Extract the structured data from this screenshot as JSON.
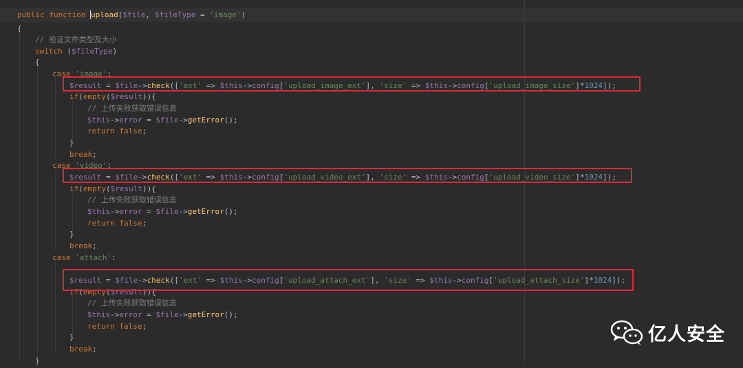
{
  "code": {
    "lines": [
      {
        "tokens": [
          {
            "t": "kw",
            "s": "public function "
          },
          {
            "t": "fnname",
            "s": "upload"
          },
          {
            "t": "p",
            "s": "("
          },
          {
            "t": "var",
            "s": "$file"
          },
          {
            "t": "p",
            "s": ", "
          },
          {
            "t": "var",
            "s": "$fileType"
          },
          {
            "t": "p",
            "s": " = "
          },
          {
            "t": "str",
            "s": "'image'"
          },
          {
            "t": "p",
            "s": ")"
          }
        ]
      },
      {
        "tokens": [
          {
            "t": "p",
            "s": "{"
          }
        ]
      },
      {
        "tokens": [
          {
            "t": "cm",
            "s": "// 验证文件类型及大小"
          }
        ]
      },
      {
        "tokens": [
          {
            "t": "kw",
            "s": "switch "
          },
          {
            "t": "p",
            "s": "("
          },
          {
            "t": "var",
            "s": "$fileType"
          },
          {
            "t": "p",
            "s": ")"
          }
        ]
      },
      {
        "tokens": [
          {
            "t": "p",
            "s": "{"
          }
        ]
      },
      {
        "tokens": [
          {
            "t": "kw",
            "s": "case "
          },
          {
            "t": "str",
            "s": "'image'"
          },
          {
            "t": "p",
            "s": ":"
          }
        ]
      },
      {
        "tokens": [
          {
            "t": "var",
            "s": "$result"
          },
          {
            "t": "p",
            "s": " = "
          },
          {
            "t": "var",
            "s": "$file"
          },
          {
            "t": "p",
            "s": "->"
          },
          {
            "t": "fn",
            "s": "check"
          },
          {
            "t": "p",
            "s": "(["
          },
          {
            "t": "str",
            "s": "'ext'"
          },
          {
            "t": "p",
            "s": " => "
          },
          {
            "t": "var",
            "s": "$this"
          },
          {
            "t": "p",
            "s": "->"
          },
          {
            "t": "var",
            "s": "config"
          },
          {
            "t": "p",
            "s": "["
          },
          {
            "t": "str",
            "s": "'upload_image_ext'"
          },
          {
            "t": "p",
            "s": "], "
          },
          {
            "t": "str",
            "s": "'size'"
          },
          {
            "t": "p",
            "s": " => "
          },
          {
            "t": "var",
            "s": "$this"
          },
          {
            "t": "p",
            "s": "->"
          },
          {
            "t": "var",
            "s": "config"
          },
          {
            "t": "p",
            "s": "["
          },
          {
            "t": "str",
            "s": "'upload_image_size'"
          },
          {
            "t": "p",
            "s": "]*"
          },
          {
            "t": "num",
            "s": "1024"
          },
          {
            "t": "p",
            "s": "]);"
          }
        ]
      },
      {
        "tokens": [
          {
            "t": "kw",
            "s": "if"
          },
          {
            "t": "p",
            "s": "("
          },
          {
            "t": "kw",
            "s": "empty"
          },
          {
            "t": "p",
            "s": "("
          },
          {
            "t": "var",
            "s": "$result"
          },
          {
            "t": "p",
            "s": ")){"
          }
        ]
      },
      {
        "tokens": [
          {
            "t": "cm",
            "s": "// 上传失败获取错误信息"
          }
        ]
      },
      {
        "tokens": [
          {
            "t": "var",
            "s": "$this"
          },
          {
            "t": "p",
            "s": "->"
          },
          {
            "t": "var",
            "s": "error"
          },
          {
            "t": "p",
            "s": " = "
          },
          {
            "t": "var",
            "s": "$file"
          },
          {
            "t": "p",
            "s": "->"
          },
          {
            "t": "fn",
            "s": "getError"
          },
          {
            "t": "p",
            "s": "();"
          }
        ]
      },
      {
        "tokens": [
          {
            "t": "kw",
            "s": "return false"
          },
          {
            "t": "p",
            "s": ";"
          }
        ]
      },
      {
        "tokens": [
          {
            "t": "p",
            "s": "}"
          }
        ]
      },
      {
        "tokens": [
          {
            "t": "kw",
            "s": "break"
          },
          {
            "t": "p",
            "s": ";"
          }
        ]
      },
      {
        "tokens": [
          {
            "t": "kw",
            "s": "case "
          },
          {
            "t": "str",
            "s": "'video'"
          },
          {
            "t": "p",
            "s": ":"
          }
        ]
      },
      {
        "tokens": [
          {
            "t": "var",
            "s": "$result"
          },
          {
            "t": "p",
            "s": " = "
          },
          {
            "t": "var",
            "s": "$file"
          },
          {
            "t": "p",
            "s": "->"
          },
          {
            "t": "fn",
            "s": "check"
          },
          {
            "t": "p",
            "s": "(["
          },
          {
            "t": "str",
            "s": "'ext'"
          },
          {
            "t": "p",
            "s": " => "
          },
          {
            "t": "var",
            "s": "$this"
          },
          {
            "t": "p",
            "s": "->"
          },
          {
            "t": "var",
            "s": "config"
          },
          {
            "t": "p",
            "s": "["
          },
          {
            "t": "str",
            "s": "'upload_video_ext'"
          },
          {
            "t": "p",
            "s": "], "
          },
          {
            "t": "str",
            "s": "'size'"
          },
          {
            "t": "p",
            "s": " => "
          },
          {
            "t": "var",
            "s": "$this"
          },
          {
            "t": "p",
            "s": "->"
          },
          {
            "t": "var",
            "s": "config"
          },
          {
            "t": "p",
            "s": "["
          },
          {
            "t": "str",
            "s": "'upload_video_size'"
          },
          {
            "t": "p",
            "s": "]*"
          },
          {
            "t": "num",
            "s": "1024"
          },
          {
            "t": "p",
            "s": "]);"
          }
        ]
      },
      {
        "tokens": [
          {
            "t": "kw",
            "s": "if"
          },
          {
            "t": "p",
            "s": "("
          },
          {
            "t": "kw",
            "s": "empty"
          },
          {
            "t": "p",
            "s": "("
          },
          {
            "t": "var",
            "s": "$result"
          },
          {
            "t": "p",
            "s": ")){"
          }
        ]
      },
      {
        "tokens": [
          {
            "t": "cm",
            "s": "// 上传失败获取错误信息"
          }
        ]
      },
      {
        "tokens": [
          {
            "t": "var",
            "s": "$this"
          },
          {
            "t": "p",
            "s": "->"
          },
          {
            "t": "var",
            "s": "error"
          },
          {
            "t": "p",
            "s": " = "
          },
          {
            "t": "var",
            "s": "$file"
          },
          {
            "t": "p",
            "s": "->"
          },
          {
            "t": "fn",
            "s": "getError"
          },
          {
            "t": "p",
            "s": "();"
          }
        ]
      },
      {
        "tokens": [
          {
            "t": "kw",
            "s": "return false"
          },
          {
            "t": "p",
            "s": ";"
          }
        ]
      },
      {
        "tokens": [
          {
            "t": "p",
            "s": "}"
          }
        ]
      },
      {
        "tokens": [
          {
            "t": "kw",
            "s": "break"
          },
          {
            "t": "p",
            "s": ";"
          }
        ]
      },
      {
        "tokens": [
          {
            "t": "kw",
            "s": "case "
          },
          {
            "t": "str",
            "s": "'attach'"
          },
          {
            "t": "p",
            "s": ":"
          }
        ]
      },
      {
        "tokens": []
      },
      {
        "tokens": [
          {
            "t": "var",
            "s": "$result"
          },
          {
            "t": "p",
            "s": " = "
          },
          {
            "t": "var",
            "s": "$file"
          },
          {
            "t": "p",
            "s": "->"
          },
          {
            "t": "fn",
            "s": "check"
          },
          {
            "t": "p",
            "s": "(["
          },
          {
            "t": "str",
            "s": "'ext'"
          },
          {
            "t": "p",
            "s": " => "
          },
          {
            "t": "var",
            "s": "$this"
          },
          {
            "t": "p",
            "s": "->"
          },
          {
            "t": "var",
            "s": "config"
          },
          {
            "t": "p",
            "s": "["
          },
          {
            "t": "str",
            "s": "'upload_attach_ext'"
          },
          {
            "t": "p",
            "s": "], "
          },
          {
            "t": "str",
            "s": "'size'"
          },
          {
            "t": "p",
            "s": " => "
          },
          {
            "t": "var",
            "s": "$this"
          },
          {
            "t": "p",
            "s": "->"
          },
          {
            "t": "var",
            "s": "config"
          },
          {
            "t": "p",
            "s": "["
          },
          {
            "t": "str",
            "s": "'upload_attach_size'"
          },
          {
            "t": "p",
            "s": "]*"
          },
          {
            "t": "num",
            "s": "1024"
          },
          {
            "t": "p",
            "s": "]);"
          }
        ]
      },
      {
        "tokens": [
          {
            "t": "kw",
            "s": "if"
          },
          {
            "t": "p",
            "s": "("
          },
          {
            "t": "kw",
            "s": "empty"
          },
          {
            "t": "p",
            "s": "("
          },
          {
            "t": "var",
            "s": "$result"
          },
          {
            "t": "p",
            "s": ")){"
          }
        ]
      },
      {
        "tokens": [
          {
            "t": "cm",
            "s": "// 上传失败获取错误信息"
          }
        ]
      },
      {
        "tokens": [
          {
            "t": "var",
            "s": "$this"
          },
          {
            "t": "p",
            "s": "->"
          },
          {
            "t": "var",
            "s": "error"
          },
          {
            "t": "p",
            "s": " = "
          },
          {
            "t": "var",
            "s": "$file"
          },
          {
            "t": "p",
            "s": "->"
          },
          {
            "t": "fn",
            "s": "getError"
          },
          {
            "t": "p",
            "s": "();"
          }
        ]
      },
      {
        "tokens": [
          {
            "t": "kw",
            "s": "return false"
          },
          {
            "t": "p",
            "s": ";"
          }
        ]
      },
      {
        "tokens": [
          {
            "t": "p",
            "s": "}"
          }
        ]
      },
      {
        "tokens": [
          {
            "t": "kw",
            "s": "break"
          },
          {
            "t": "p",
            "s": ";"
          }
        ]
      },
      {
        "tokens": [
          {
            "t": "p",
            "s": "}"
          }
        ]
      }
    ]
  },
  "colors": {
    "background": "#2b2b2b",
    "highlight_box": "#e0283a",
    "keyword": "#cc7832",
    "variable": "#9876aa",
    "string": "#6a8759",
    "comment": "#808080",
    "number": "#6897bb",
    "function": "#ffc66d",
    "plain": "#a9b7c6"
  },
  "highlight_icon": "rectangle-highlight",
  "watermark": {
    "icon": "wechat-icon",
    "text": "亿人安全"
  }
}
